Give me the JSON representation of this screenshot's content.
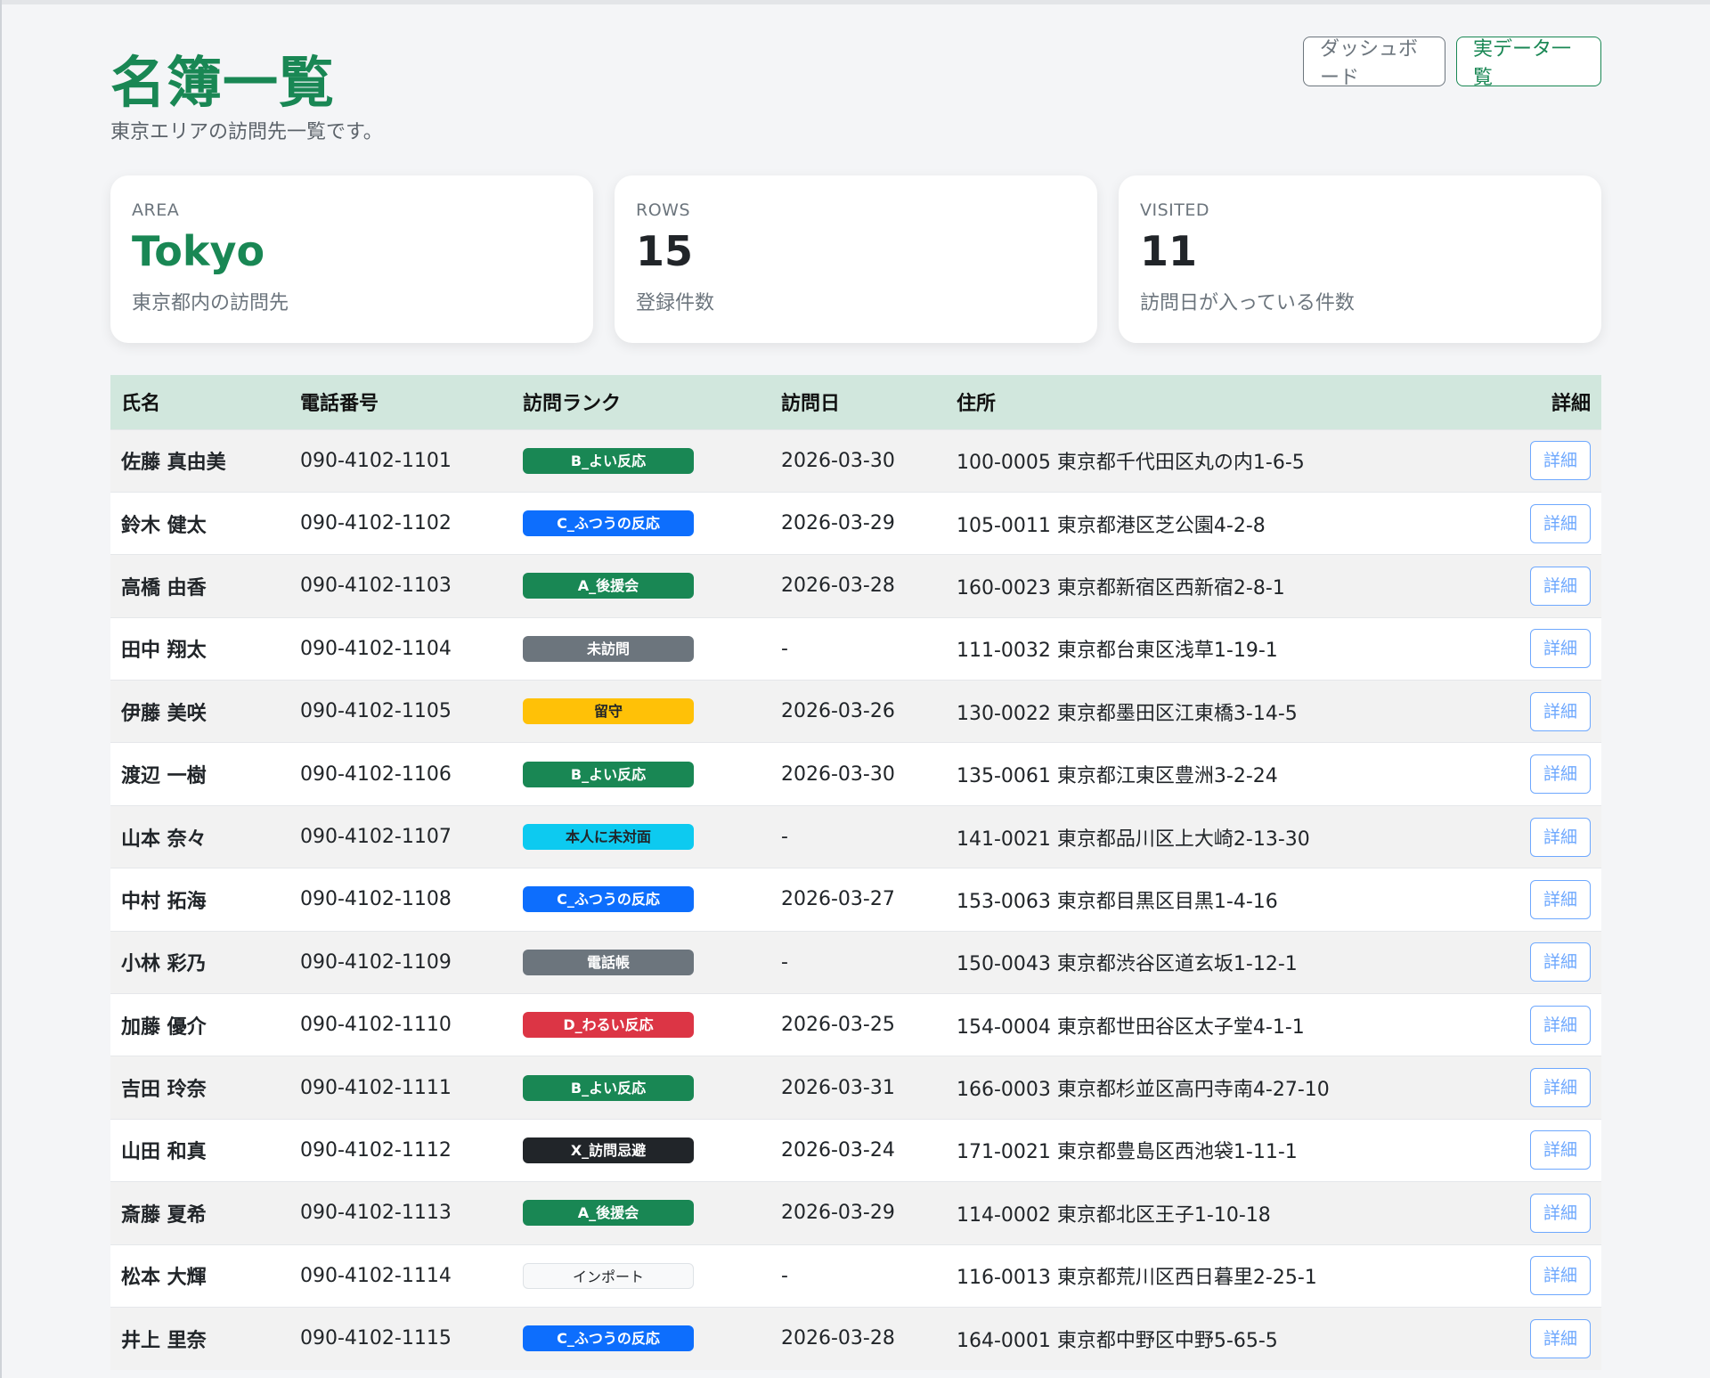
{
  "header": {
    "title": "名簿一覧",
    "subtitle": "東京エリアの訪問先一覧です。",
    "dashboard_label": "ダッシュボード",
    "realdata_label": "実データ一覧"
  },
  "cards": {
    "area": {
      "label": "AREA",
      "value": "Tokyo",
      "desc": "東京都内の訪問先"
    },
    "rows": {
      "label": "ROWS",
      "value": "15",
      "desc": "登録件数"
    },
    "visited": {
      "label": "VISITED",
      "value": "11",
      "desc": "訪問日が入っている件数"
    }
  },
  "table": {
    "headers": {
      "name": "氏名",
      "phone": "電話番号",
      "rank": "訪問ランク",
      "date": "訪問日",
      "address": "住所",
      "detail": "詳細"
    },
    "detail_button_label": "詳細",
    "rank_colors": {
      "B_よい反応": "#198754",
      "A_後援会": "#198754",
      "C_ふつうの反応": "#0d6efd",
      "未訪問": "#6c757d",
      "電話帳": "#6c757d",
      "留守": "#ffc107",
      "本人に未対面": "#0dcaf0",
      "D_わるい反応": "#dc3545",
      "X_訪問忌避": "#212529",
      "インポート": "#f8f9fa"
    },
    "rows": [
      {
        "name": "佐藤 真由美",
        "phone": "090-4102-1101",
        "rank": "B_よい反応",
        "rank_class": "rank-green",
        "date": "2026-03-30",
        "address": "100-0005 東京都千代田区丸の内1-6-5"
      },
      {
        "name": "鈴木 健太",
        "phone": "090-4102-1102",
        "rank": "C_ふつうの反応",
        "rank_class": "rank-blue",
        "date": "2026-03-29",
        "address": "105-0011 東京都港区芝公園4-2-8"
      },
      {
        "name": "高橋 由香",
        "phone": "090-4102-1103",
        "rank": "A_後援会",
        "rank_class": "rank-green",
        "date": "2026-03-28",
        "address": "160-0023 東京都新宿区西新宿2-8-1"
      },
      {
        "name": "田中 翔太",
        "phone": "090-4102-1104",
        "rank": "未訪問",
        "rank_class": "rank-gray",
        "date": "-",
        "address": "111-0032 東京都台東区浅草1-19-1"
      },
      {
        "name": "伊藤 美咲",
        "phone": "090-4102-1105",
        "rank": "留守",
        "rank_class": "rank-yellow",
        "date": "2026-03-26",
        "address": "130-0022 東京都墨田区江東橋3-14-5"
      },
      {
        "name": "渡辺 一樹",
        "phone": "090-4102-1106",
        "rank": "B_よい反応",
        "rank_class": "rank-green",
        "date": "2026-03-30",
        "address": "135-0061 東京都江東区豊洲3-2-24"
      },
      {
        "name": "山本 奈々",
        "phone": "090-4102-1107",
        "rank": "本人に未対面",
        "rank_class": "rank-cyan",
        "date": "-",
        "address": "141-0021 東京都品川区上大崎2-13-30"
      },
      {
        "name": "中村 拓海",
        "phone": "090-4102-1108",
        "rank": "C_ふつうの反応",
        "rank_class": "rank-blue",
        "date": "2026-03-27",
        "address": "153-0063 東京都目黒区目黒1-4-16"
      },
      {
        "name": "小林 彩乃",
        "phone": "090-4102-1109",
        "rank": "電話帳",
        "rank_class": "rank-gray",
        "date": "-",
        "address": "150-0043 東京都渋谷区道玄坂1-12-1"
      },
      {
        "name": "加藤 優介",
        "phone": "090-4102-1110",
        "rank": "D_わるい反応",
        "rank_class": "rank-red",
        "date": "2026-03-25",
        "address": "154-0004 東京都世田谷区太子堂4-1-1"
      },
      {
        "name": "吉田 玲奈",
        "phone": "090-4102-1111",
        "rank": "B_よい反応",
        "rank_class": "rank-green",
        "date": "2026-03-31",
        "address": "166-0003 東京都杉並区高円寺南4-27-10"
      },
      {
        "name": "山田 和真",
        "phone": "090-4102-1112",
        "rank": "X_訪問忌避",
        "rank_class": "rank-dark",
        "date": "2026-03-24",
        "address": "171-0021 東京都豊島区西池袋1-11-1"
      },
      {
        "name": "斎藤 夏希",
        "phone": "090-4102-1113",
        "rank": "A_後援会",
        "rank_class": "rank-green",
        "date": "2026-03-29",
        "address": "114-0002 東京都北区王子1-10-18"
      },
      {
        "name": "松本 大輝",
        "phone": "090-4102-1114",
        "rank": "インポート",
        "rank_class": "rank-light",
        "date": "-",
        "address": "116-0013 東京都荒川区西日暮里2-25-1"
      },
      {
        "name": "井上 里奈",
        "phone": "090-4102-1115",
        "rank": "C_ふつうの反応",
        "rank_class": "rank-blue",
        "date": "2026-03-28",
        "address": "164-0001 東京都中野区中野5-65-5"
      }
    ]
  }
}
